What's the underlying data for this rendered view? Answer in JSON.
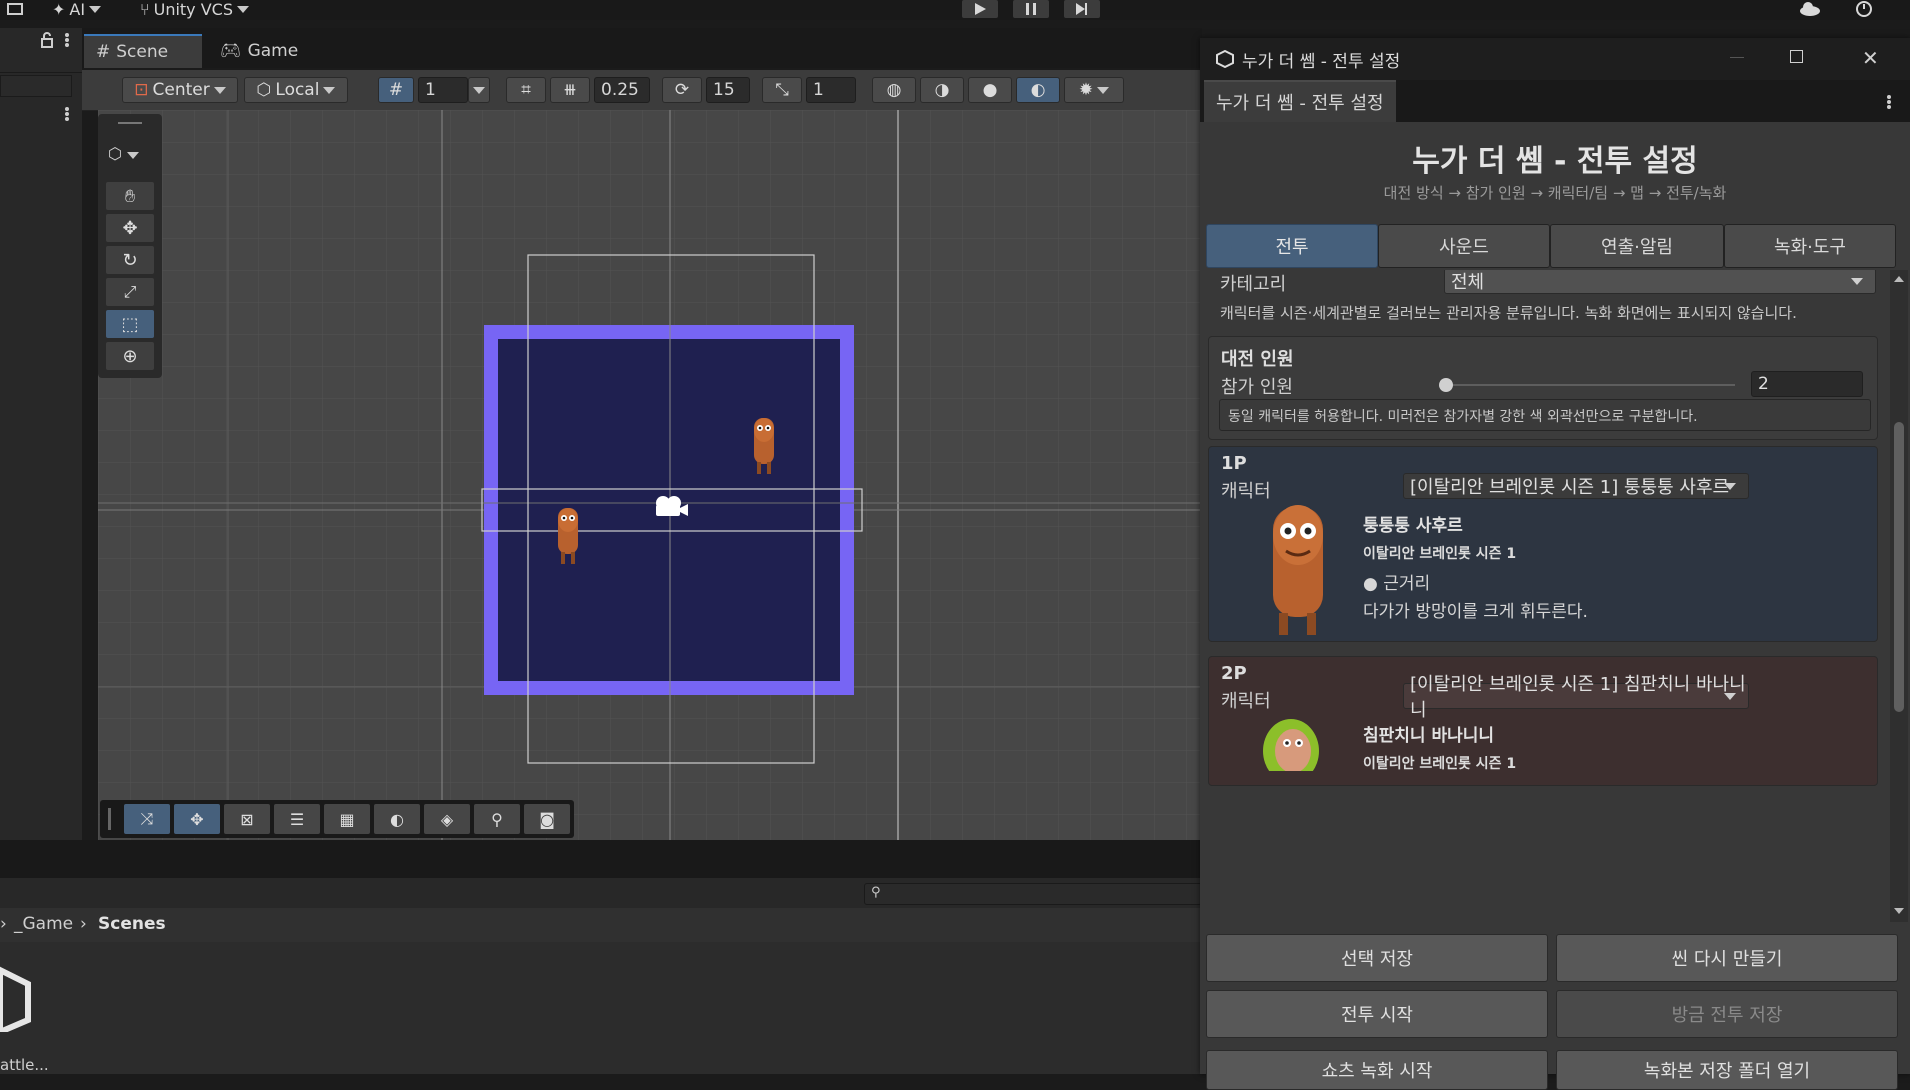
{
  "top_bar": {
    "ai_label": "AI",
    "vcs_label": "Unity VCS"
  },
  "scene_tabs": [
    {
      "label": "Scene"
    },
    {
      "label": "Game"
    }
  ],
  "scene_toolbar": {
    "pivot": "Center",
    "space": "Local",
    "grid_size": "1",
    "snap_increment": "0.25",
    "rotate_snap": "15",
    "scale_snap": "1"
  },
  "project": {
    "breadcrumb": [
      "_Game",
      "Scenes"
    ],
    "asset_name": "attle..."
  },
  "window": {
    "title": "누가 더 쎔 - 전투 설정",
    "tab": "누가 더 쎔 - 전투 설정",
    "header_title": "누가 더 쎔 - 전투 설정",
    "header_subtitle": "대전 방식 → 참가 인원 → 캐릭터/팀 → 맵 → 전투/녹화",
    "tabs": [
      {
        "label": "전투",
        "active": true
      },
      {
        "label": "사운드",
        "active": false
      },
      {
        "label": "연출·알림",
        "active": false
      },
      {
        "label": "녹화·도구",
        "active": false
      }
    ],
    "category": {
      "label": "카테고리",
      "value": "전체",
      "help": "캐릭터를 시즌·세계관별로 걸러보는 관리자용 분류입니다. 녹화 화면에는 표시되지 않습니다."
    },
    "match_size": {
      "title": "대전 인원",
      "label": "참가 인원",
      "value": "2",
      "slider_fraction": 0.0,
      "help": "동일 캐릭터를 허용합니다. 미러전은 참가자별 강한 색 외곽선만으로 구분합니다."
    },
    "players": [
      {
        "tag": "1P",
        "field_label": "캐릭터",
        "selection": "[이탈리안 브레인롯 시즌 1] 퉁퉁퉁 사후르",
        "name": "퉁퉁퉁 사후르",
        "season": "이탈리안 브레인롯 시즌 1",
        "attack_type": "근거리",
        "description": "다가가 방망이를 크게 휘두른다.",
        "bg": "#2d3541"
      },
      {
        "tag": "2P",
        "field_label": "캐릭터",
        "selection": "[이탈리안 브레인롯 시즌 1] 침판치니 바나니니",
        "name": "침판치니 바나니니",
        "season": "이탈리안 브레인롯 시즌 1",
        "bg": "#3d2f2f"
      }
    ],
    "buttons": [
      {
        "label": "선택 저장",
        "enabled": true
      },
      {
        "label": "씬 다시 만들기",
        "enabled": true
      },
      {
        "label": "전투 시작",
        "enabled": true
      },
      {
        "label": "방금 전투 저장",
        "enabled": false
      },
      {
        "label": "쇼츠 녹화 시작",
        "enabled": true
      },
      {
        "label": "녹화본 저장 폴더 열기",
        "enabled": true
      }
    ]
  },
  "colors": {
    "accent_blue": "#46607c",
    "arena_border": "#7765f4",
    "arena_fill": "#1f2050"
  }
}
